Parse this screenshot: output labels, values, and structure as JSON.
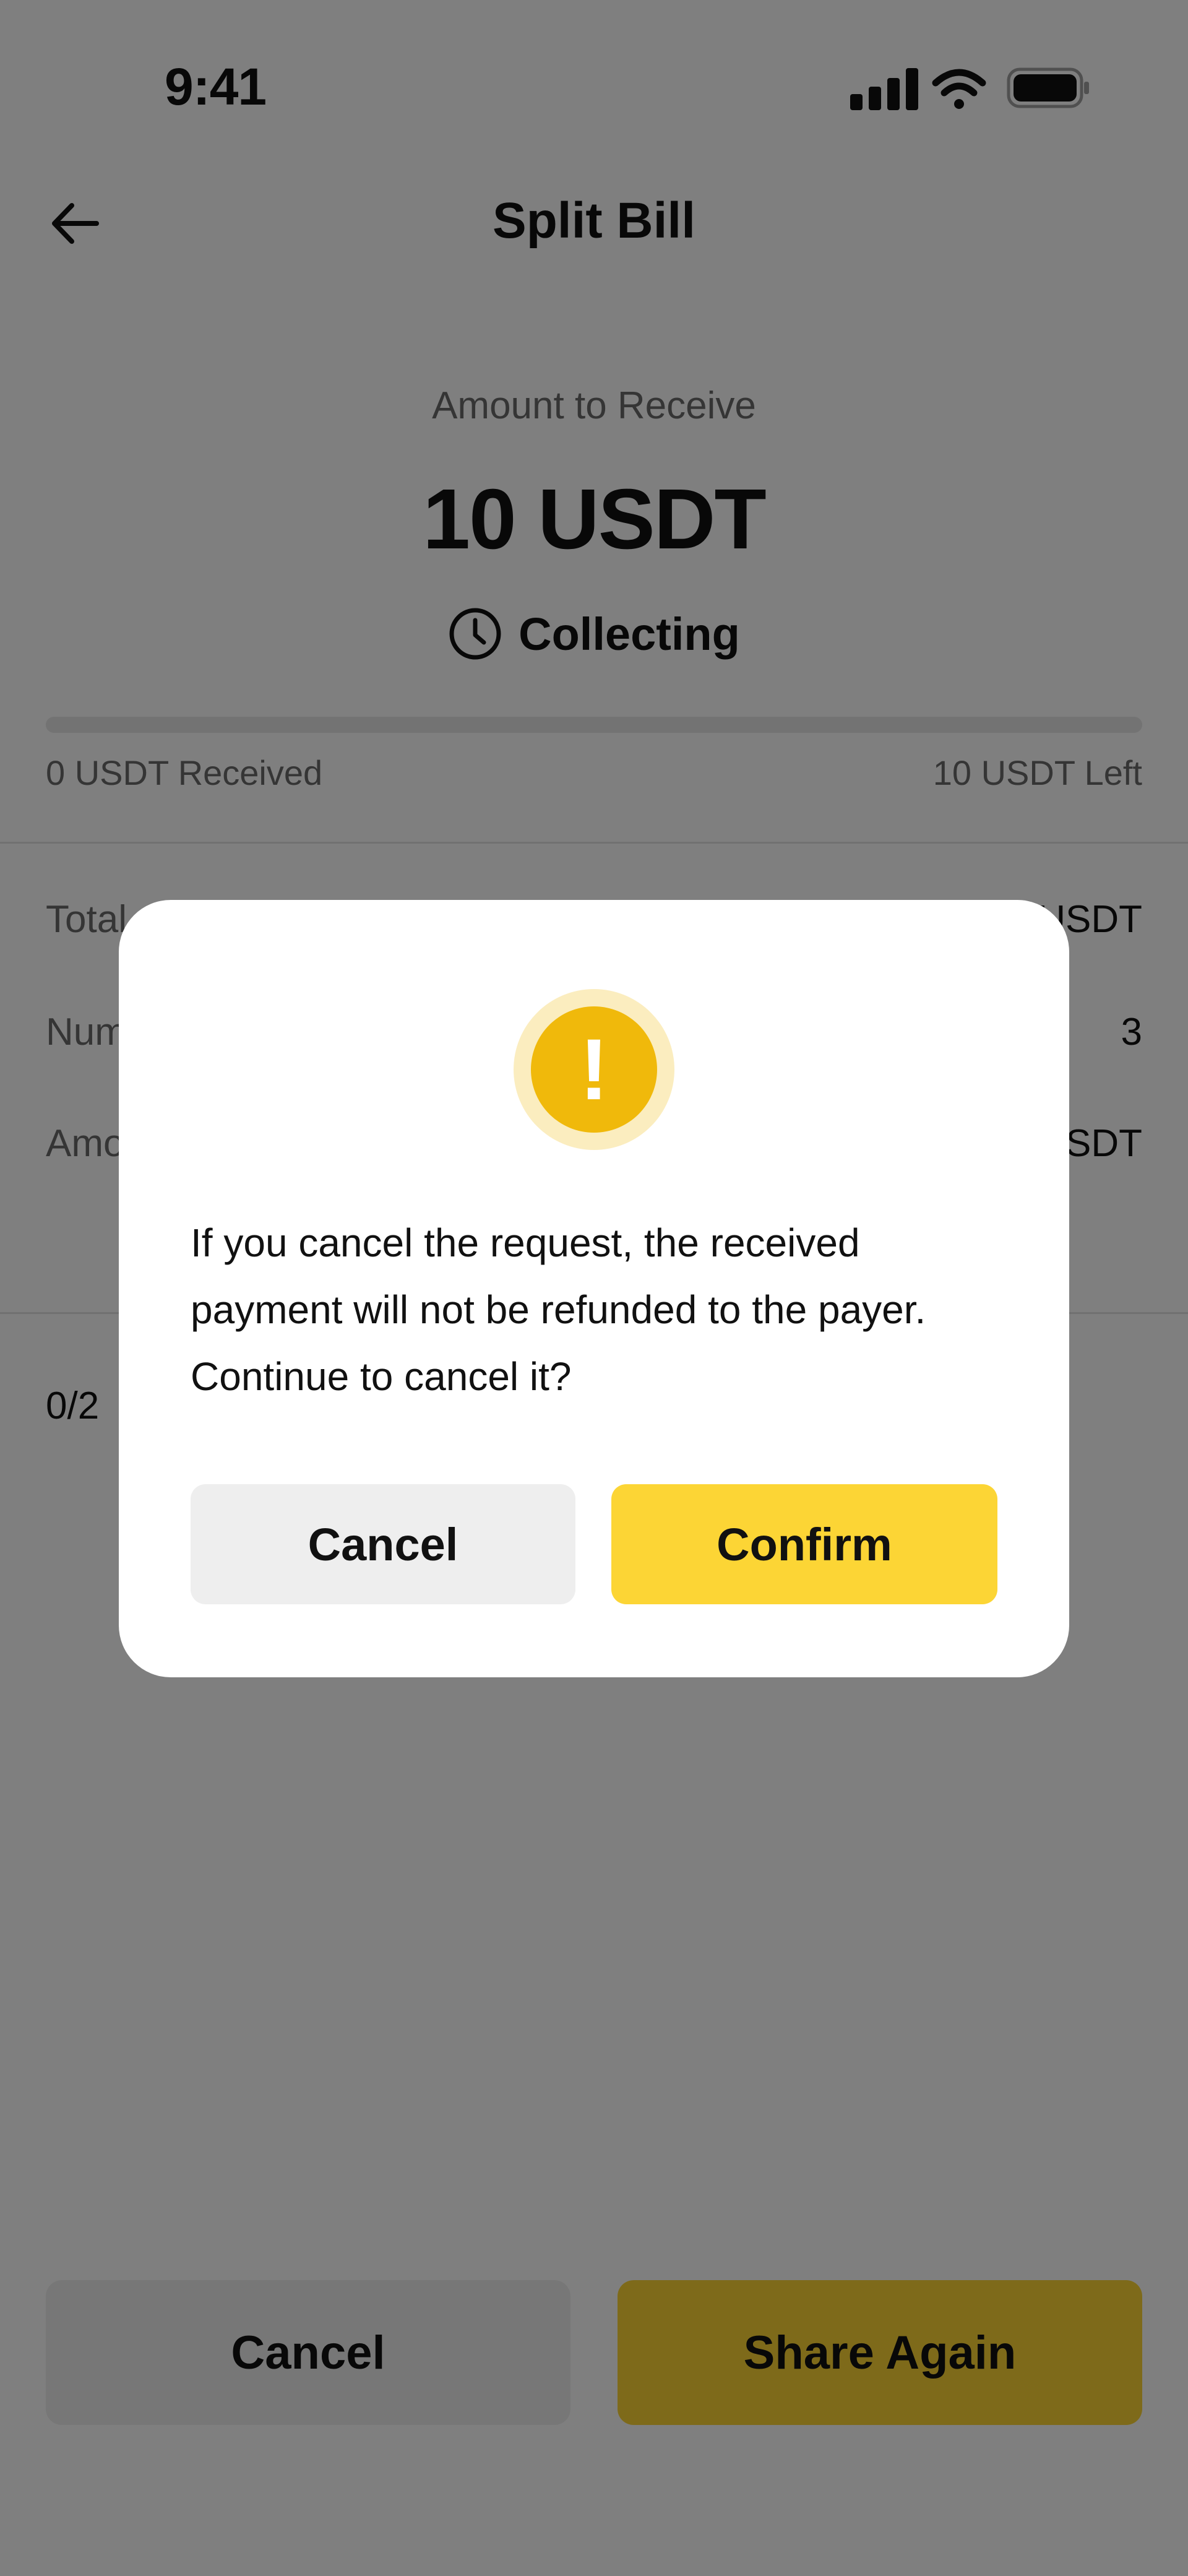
{
  "status_bar": {
    "time": "9:41",
    "icons": [
      "cellular-signal-icon",
      "wifi-icon",
      "battery-icon"
    ]
  },
  "header": {
    "title": "Split Bill",
    "back_icon": "arrow-left-icon"
  },
  "summary": {
    "amount_label": "Amount to Receive",
    "amount": "10 USDT",
    "status_icon": "clock-icon",
    "status": "Collecting",
    "progress_fraction": 0,
    "received_text": "0 USDT Received",
    "left_text": "10 USDT Left"
  },
  "details": {
    "rows": [
      {
        "label": "Total",
        "value": "USDT"
      },
      {
        "label": "Num",
        "value": "3"
      },
      {
        "label": "Amo",
        "value": "USDT"
      }
    ],
    "paid_count": "0/2"
  },
  "footer": {
    "cancel_label": "Cancel",
    "share_label": "Share Again"
  },
  "dialog": {
    "icon": "warning-icon",
    "icon_glyph": "!",
    "message": "If you cancel the request, the received payment will not be refunded to the payer. Continue to cancel it?",
    "cancel_label": "Cancel",
    "confirm_label": "Confirm"
  },
  "colors": {
    "accent": "#fcd535",
    "warning": "#f0b90b",
    "warning_halo": "#fbedbf",
    "overlay": "rgba(0,0,0,0.5)"
  }
}
